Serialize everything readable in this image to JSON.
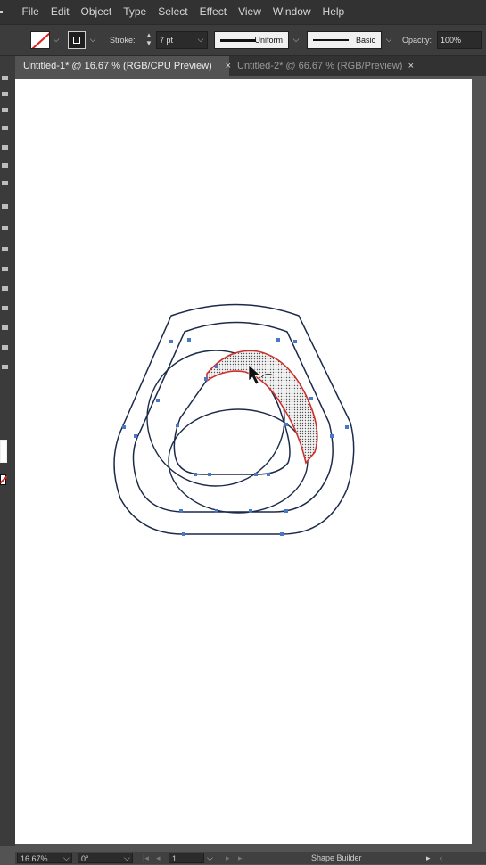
{
  "menu": {
    "items": [
      "File",
      "Edit",
      "Object",
      "Type",
      "Select",
      "Effect",
      "View",
      "Window",
      "Help"
    ]
  },
  "options": {
    "stroke_label": "Stroke:",
    "stroke_weight": "7 pt",
    "variable_width_profile": "Uniform",
    "brush": "Basic",
    "opacity_label": "Opacity:",
    "opacity_value": "100%"
  },
  "tabs": [
    {
      "label": "Untitled-1* @ 16.67 % (RGB/CPU Preview)",
      "close": "×",
      "active": true
    },
    {
      "label": "Untitled-2* @ 66.67 % (RGB/Preview)",
      "close": "×",
      "active": false
    }
  ],
  "status": {
    "zoom": "16.67%",
    "rotation": "0°",
    "artboard_number": "1",
    "current_tool": "Shape Builder"
  },
  "colors": {
    "path_stroke": "#1c2a4a",
    "anchor_point": "#4a78c8",
    "highlight_stroke": "#d0302a",
    "ui_dark": "#323232"
  }
}
